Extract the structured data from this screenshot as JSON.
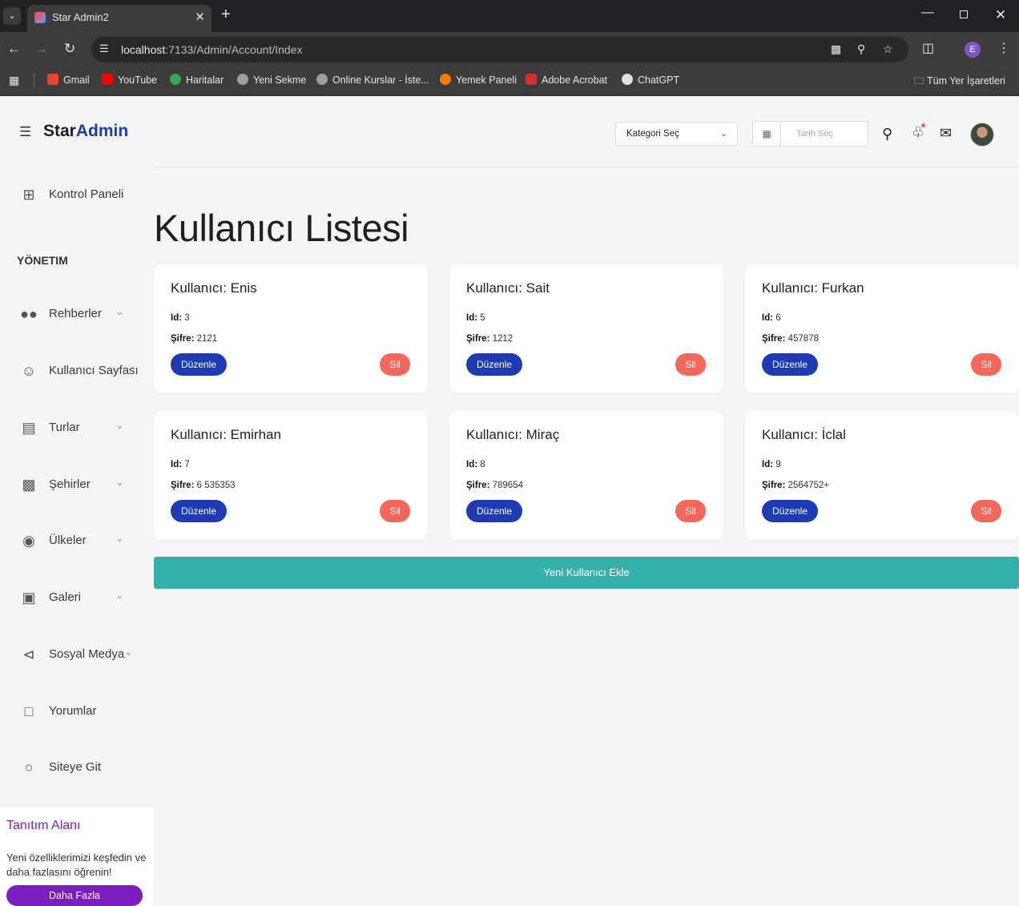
{
  "browser": {
    "tab_title": "Star Admin2",
    "url_host": "localhost",
    "url_path": ":7133/Admin/Account/Index",
    "profile_initial": "E",
    "bookmarks": [
      {
        "label": "Gmail",
        "color": "#ea4335"
      },
      {
        "label": "YouTube",
        "color": "#ff0000"
      },
      {
        "label": "Haritalar",
        "color": "#34a853"
      },
      {
        "label": "Yeni Sekme",
        "color": "#9e9e9e"
      },
      {
        "label": "Online Kurslar - İste...",
        "color": "#9e9e9e"
      },
      {
        "label": "Yemek Paneli",
        "color": "#f57c00"
      },
      {
        "label": "Adobe Acrobat",
        "color": "#d32f2f"
      },
      {
        "label": "ChatGPT",
        "color": "#e0e0e0"
      }
    ],
    "all_bookmarks": "Tüm Yer İşaretleri"
  },
  "brand": {
    "part1": "Star",
    "part2": "Admin",
    "accent_color": "#1f3bb3"
  },
  "sidebar": {
    "dashboard": "Kontrol Paneli",
    "section": "YÖNETIM",
    "items": [
      {
        "label": "Rehberler",
        "icon": "people-icon"
      },
      {
        "label": "Kullanıcı Sayfası",
        "icon": "account-circle-icon"
      },
      {
        "label": "Turlar",
        "icon": "map-icon"
      },
      {
        "label": "Şehirler",
        "icon": "city-icon"
      },
      {
        "label": "Ülkeler",
        "icon": "globe-icon"
      },
      {
        "label": "Galeri",
        "icon": "image-icon"
      },
      {
        "label": "Sosyal Medya",
        "icon": "share-icon"
      },
      {
        "label": "Yorumlar",
        "icon": "comment-icon"
      },
      {
        "label": "Siteye Git",
        "icon": "web-icon"
      }
    ]
  },
  "promo": {
    "title": "Tanıtım Alanı",
    "text": "Yeni özelliklerimizi keşfedin ve daha fazlasını öğrenin!",
    "button": "Daha Fazla",
    "color": "#7a1fbd"
  },
  "topbar": {
    "category_select": "Kategori Seç",
    "date_placeholder": "Tarih Seç"
  },
  "page_title": "Kullanıcı Listesi",
  "labels": {
    "id": "Id:",
    "password": "Şifre:",
    "edit": "Düzenle",
    "delete": "Sil"
  },
  "users": [
    {
      "title": "Kullanıcı: Enis",
      "id": "3",
      "password": "2121"
    },
    {
      "title": "Kullanıcı: Sait",
      "id": "5",
      "password": "1212"
    },
    {
      "title": "Kullanıcı: Furkan",
      "id": "6",
      "password": "457878"
    },
    {
      "title": "Kullanıcı: Emirhan",
      "id": "7",
      "password": "6 535353"
    },
    {
      "title": "Kullanıcı: Miraç",
      "id": "8",
      "password": "789654"
    },
    {
      "title": "Kullanıcı: İclal",
      "id": "9",
      "password": "2564752+"
    }
  ],
  "add_button": "Yeni Kullanıcı Ekle",
  "colors": {
    "edit": "#1f3bb3",
    "delete": "#f4675a",
    "add": "#34b1aa"
  }
}
